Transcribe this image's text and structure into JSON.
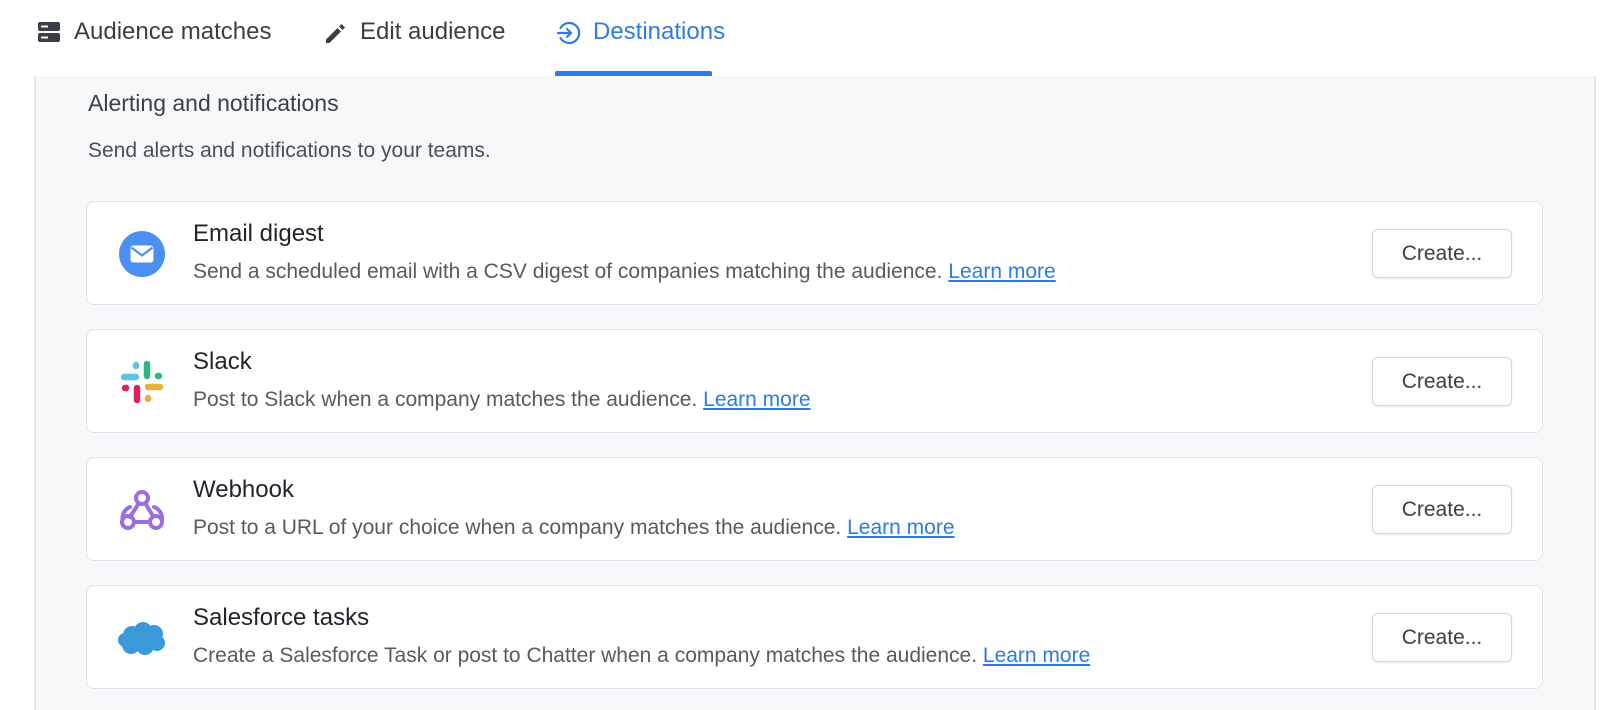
{
  "tabs": {
    "matches": {
      "label": "Audience matches",
      "icon": "server-stack-icon"
    },
    "edit": {
      "label": "Edit audience",
      "icon": "pencil-icon"
    },
    "destinations": {
      "label": "Destinations",
      "icon": "sign-in-arrow-icon",
      "active": true
    }
  },
  "section": {
    "title": "Alerting and notifications",
    "description": "Send alerts and notifications to your teams."
  },
  "destinations": [
    {
      "title": "Email digest",
      "description": "Send a scheduled email with a CSV digest of companies matching the audience.",
      "link": "Learn more",
      "button": "Create...",
      "icon": "email-icon"
    },
    {
      "title": "Slack",
      "description": "Post to Slack when a company matches the audience.",
      "link": "Learn more",
      "button": "Create...",
      "icon": "slack-icon"
    },
    {
      "title": "Webhook",
      "description": "Post to a URL of your choice when a company matches the audience.",
      "link": "Learn more",
      "button": "Create...",
      "icon": "webhook-icon"
    },
    {
      "title": "Salesforce tasks",
      "description": "Create a Salesforce Task or post to Chatter when a company matches the audience.",
      "link": "Learn more",
      "button": "Create...",
      "icon": "salesforce-cloud-icon"
    }
  ],
  "colors": {
    "accent": "#2f7ae5",
    "panel_bg": "#f7f8fa",
    "email_blue": "#4a90f0",
    "webhook_purple": "#9b6de0",
    "salesforce_blue": "#3a9ad9"
  }
}
